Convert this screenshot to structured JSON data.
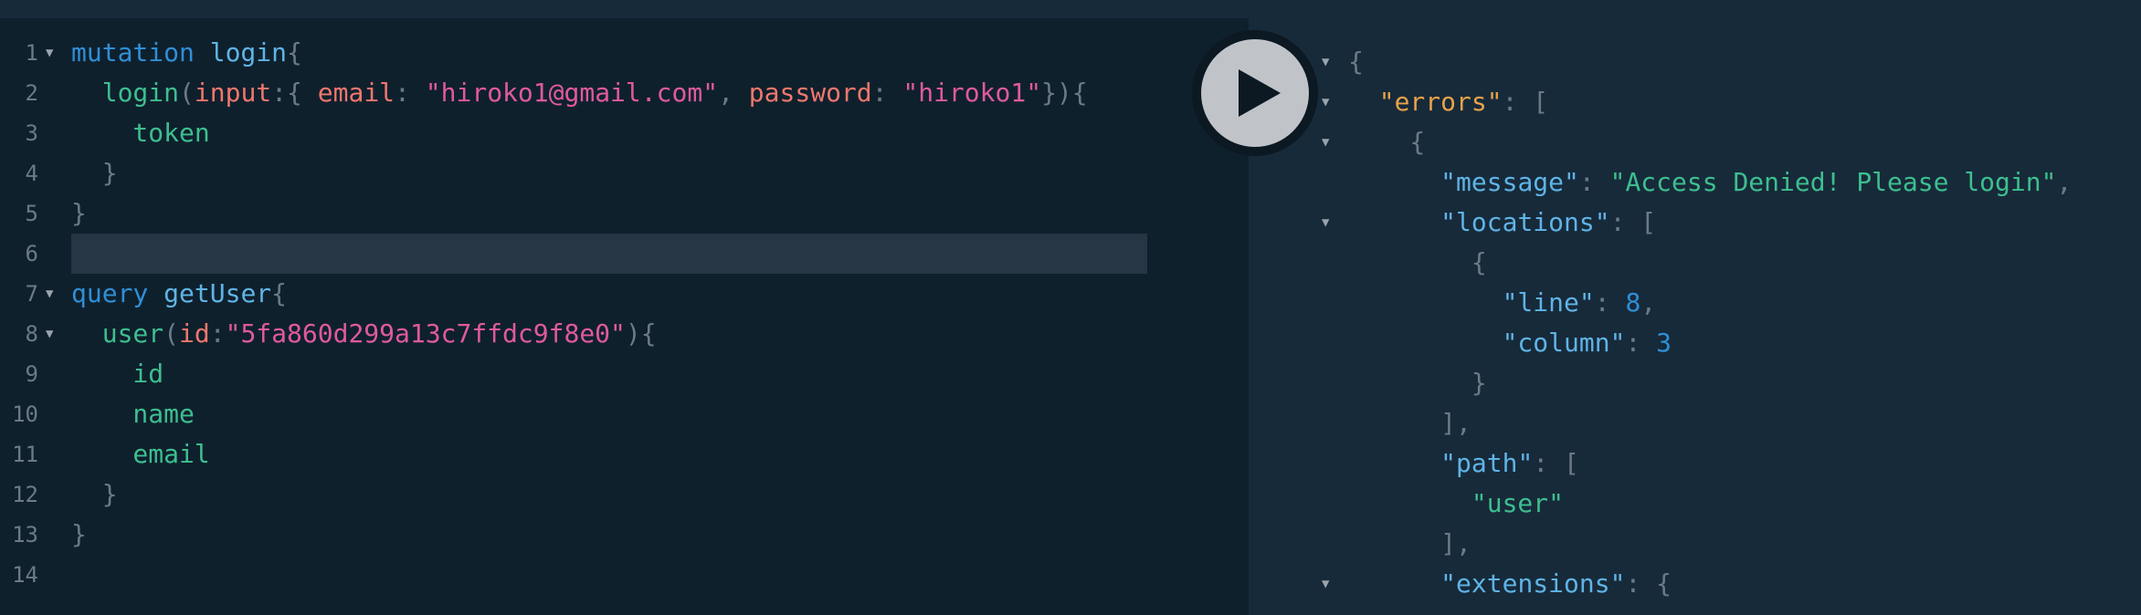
{
  "editor": {
    "line_numbers": [
      "1",
      "2",
      "3",
      "4",
      "5",
      "6",
      "7",
      "8",
      "9",
      "10",
      "11",
      "12",
      "13",
      "14"
    ],
    "lines": [
      {
        "segments": [
          {
            "t": "mutation ",
            "c": "kw"
          },
          {
            "t": "login",
            "c": "fn"
          },
          {
            "t": "{",
            "c": "pun"
          }
        ]
      },
      {
        "segments": [
          {
            "t": "  login",
            "c": "field"
          },
          {
            "t": "(",
            "c": "pun"
          },
          {
            "t": "input",
            "c": "arg"
          },
          {
            "t": ":{ ",
            "c": "pun"
          },
          {
            "t": "email",
            "c": "arg"
          },
          {
            "t": ": ",
            "c": "pun"
          },
          {
            "t": "\"hiroko1@gmail.com\"",
            "c": "str"
          },
          {
            "t": ", ",
            "c": "pun"
          },
          {
            "t": "password",
            "c": "arg"
          },
          {
            "t": ": ",
            "c": "pun"
          },
          {
            "t": "\"hiroko1\"",
            "c": "str"
          },
          {
            "t": "}){",
            "c": "pun"
          }
        ]
      },
      {
        "segments": [
          {
            "t": "    token",
            "c": "field"
          }
        ]
      },
      {
        "segments": [
          {
            "t": "  }",
            "c": "pun"
          }
        ]
      },
      {
        "segments": [
          {
            "t": "}",
            "c": "pun"
          }
        ]
      },
      {
        "segments": []
      },
      {
        "segments": [
          {
            "t": "query ",
            "c": "kw"
          },
          {
            "t": "getUser",
            "c": "fn"
          },
          {
            "t": "{",
            "c": "pun"
          }
        ]
      },
      {
        "segments": [
          {
            "t": "  user",
            "c": "field"
          },
          {
            "t": "(",
            "c": "pun"
          },
          {
            "t": "id",
            "c": "arg"
          },
          {
            "t": ":",
            "c": "pun"
          },
          {
            "t": "\"5fa860d299a13c7ffdc9f8e0\"",
            "c": "str"
          },
          {
            "t": "){",
            "c": "pun"
          }
        ]
      },
      {
        "segments": [
          {
            "t": "    id",
            "c": "field"
          }
        ]
      },
      {
        "segments": [
          {
            "t": "    name",
            "c": "field"
          }
        ]
      },
      {
        "segments": [
          {
            "t": "    email",
            "c": "field"
          }
        ]
      },
      {
        "segments": [
          {
            "t": "  }",
            "c": "pun"
          }
        ]
      },
      {
        "segments": [
          {
            "t": "}",
            "c": "pun"
          }
        ]
      },
      {
        "segments": []
      }
    ],
    "fold_markers": [
      true,
      false,
      false,
      false,
      false,
      false,
      true,
      true,
      false,
      false,
      false,
      false,
      false,
      false
    ]
  },
  "run_button": {
    "icon": "play-icon"
  },
  "results": {
    "lines": [
      {
        "fold": true,
        "segments": [
          {
            "t": "{",
            "c": "pun"
          }
        ]
      },
      {
        "fold": true,
        "segments": [
          {
            "t": "  ",
            "c": "pun"
          },
          {
            "t": "\"errors\"",
            "c": "rerr"
          },
          {
            "t": ": [",
            "c": "pun"
          }
        ]
      },
      {
        "fold": true,
        "segments": [
          {
            "t": "    {",
            "c": "pun"
          }
        ]
      },
      {
        "fold": false,
        "segments": [
          {
            "t": "      ",
            "c": "pun"
          },
          {
            "t": "\"message\"",
            "c": "rkey"
          },
          {
            "t": ": ",
            "c": "pun"
          },
          {
            "t": "\"Access Denied! Please login\"",
            "c": "rstr"
          },
          {
            "t": ",",
            "c": "pun"
          }
        ]
      },
      {
        "fold": true,
        "segments": [
          {
            "t": "      ",
            "c": "pun"
          },
          {
            "t": "\"locations\"",
            "c": "rkey"
          },
          {
            "t": ": [",
            "c": "pun"
          }
        ]
      },
      {
        "fold": false,
        "segments": [
          {
            "t": "        {",
            "c": "pun"
          }
        ]
      },
      {
        "fold": false,
        "segments": [
          {
            "t": "          ",
            "c": "pun"
          },
          {
            "t": "\"line\"",
            "c": "rkey"
          },
          {
            "t": ": ",
            "c": "pun"
          },
          {
            "t": "8",
            "c": "rnum"
          },
          {
            "t": ",",
            "c": "pun"
          }
        ]
      },
      {
        "fold": false,
        "segments": [
          {
            "t": "          ",
            "c": "pun"
          },
          {
            "t": "\"column\"",
            "c": "rkey"
          },
          {
            "t": ": ",
            "c": "pun"
          },
          {
            "t": "3",
            "c": "rnum"
          }
        ]
      },
      {
        "fold": false,
        "segments": [
          {
            "t": "        }",
            "c": "pun"
          }
        ]
      },
      {
        "fold": false,
        "segments": [
          {
            "t": "      ],",
            "c": "pun"
          }
        ]
      },
      {
        "fold": false,
        "segments": [
          {
            "t": "      ",
            "c": "pun"
          },
          {
            "t": "\"path\"",
            "c": "rkey"
          },
          {
            "t": ": [",
            "c": "pun"
          }
        ]
      },
      {
        "fold": false,
        "segments": [
          {
            "t": "        ",
            "c": "pun"
          },
          {
            "t": "\"user\"",
            "c": "rstr"
          }
        ]
      },
      {
        "fold": false,
        "segments": [
          {
            "t": "      ],",
            "c": "pun"
          }
        ]
      },
      {
        "fold": true,
        "segments": [
          {
            "t": "      ",
            "c": "pun"
          },
          {
            "t": "\"extensions\"",
            "c": "rkey"
          },
          {
            "t": ": {",
            "c": "pun"
          }
        ]
      }
    ]
  },
  "colors": {
    "keyword": "#2f8fd6",
    "field": "#3dbf8f",
    "argument": "#f0776d",
    "string": "#e05a9d",
    "punctuation": "#6c7a86",
    "result_key": "#5fb4e6",
    "errors_key": "#e8a349"
  }
}
